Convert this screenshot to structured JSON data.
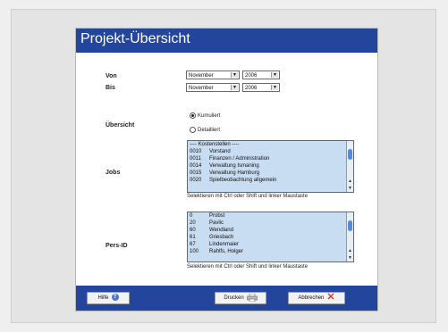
{
  "header": {
    "title": "Projekt-Übersicht"
  },
  "form": {
    "von_label": "Von",
    "bis_label": "Bis",
    "von_month": "November",
    "von_year": "2006",
    "bis_month": "November",
    "bis_year": "2006",
    "uebersicht_label": "Übersicht",
    "radio_kumuliert": "Kumuliert",
    "radio_detailliert": "Detailliert",
    "jobs_label": "Jobs",
    "pers_label": "Pers-ID",
    "hint": "Selektieren mit Ctrl oder Shift und linker Maustaste"
  },
  "jobs": {
    "header_text": "---- Kostenstellen ----",
    "items": [
      {
        "code": "0010",
        "name": "Vorstand"
      },
      {
        "code": "0011",
        "name": "Finanzen / Administration"
      },
      {
        "code": "0014",
        "name": "Verwaltung Ismaning"
      },
      {
        "code": "0015",
        "name": "Verwaltung Hamburg"
      },
      {
        "code": "0020",
        "name": "Spielbeobachtung allgemein"
      }
    ]
  },
  "pers": {
    "items": [
      {
        "code": "0",
        "name": "Probst"
      },
      {
        "code": "20",
        "name": "Pavlic"
      },
      {
        "code": "60",
        "name": "Wendland"
      },
      {
        "code": "61",
        "name": "Griesbach"
      },
      {
        "code": "67",
        "name": "Lindenmaier"
      },
      {
        "code": "100",
        "name": "Rahlfs, Holger"
      }
    ]
  },
  "footer": {
    "help_label": "Hilfe",
    "print_label": "Drucken",
    "cancel_label": "Abbrechen"
  },
  "colors": {
    "header": "#23459c",
    "listbox": "#c8dcf2",
    "cancel": "#e23a1d"
  }
}
